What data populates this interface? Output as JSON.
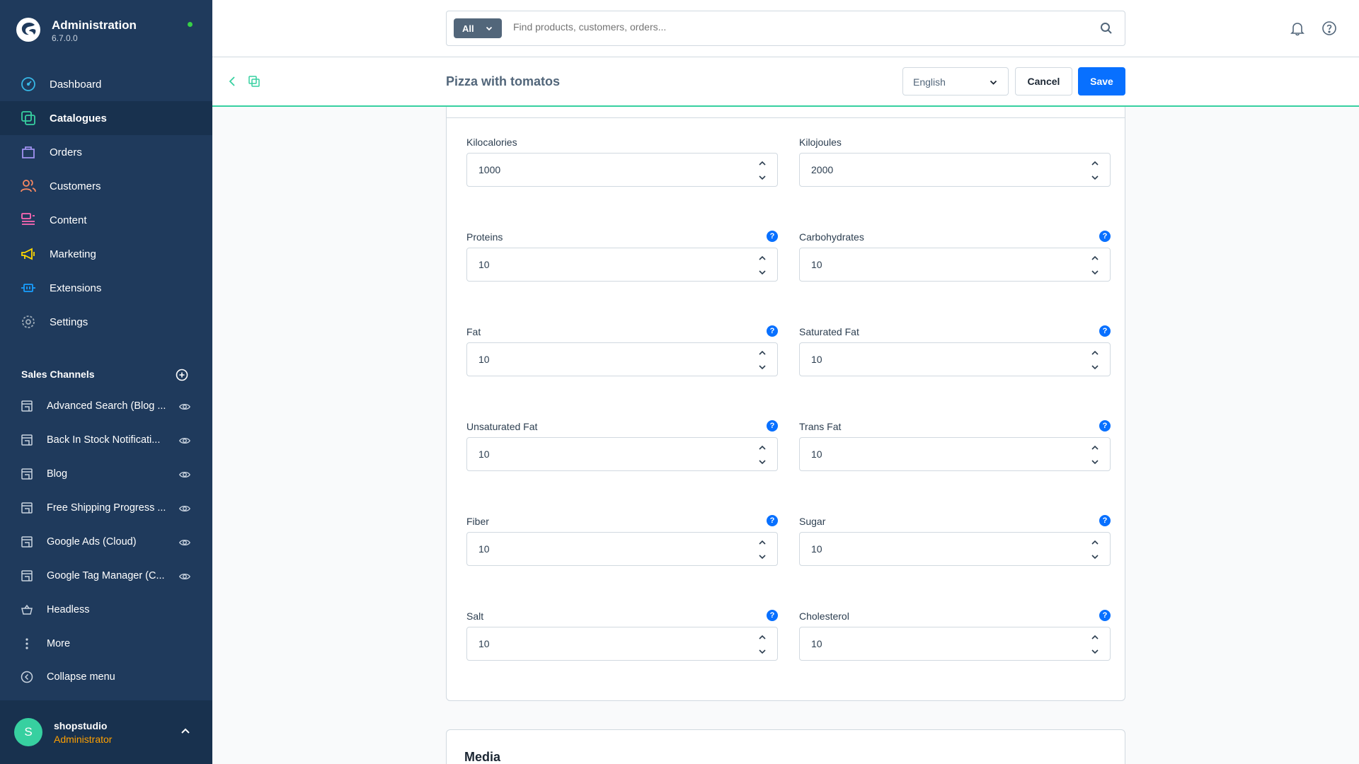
{
  "brand": {
    "title": "Administration",
    "version": "6.7.0.0"
  },
  "nav": [
    {
      "label": "Dashboard",
      "icon": "dashboard-icon"
    },
    {
      "label": "Catalogues",
      "icon": "catalogue-icon"
    },
    {
      "label": "Orders",
      "icon": "orders-icon"
    },
    {
      "label": "Customers",
      "icon": "customers-icon"
    },
    {
      "label": "Content",
      "icon": "content-icon"
    },
    {
      "label": "Marketing",
      "icon": "marketing-icon"
    },
    {
      "label": "Extensions",
      "icon": "extensions-icon"
    },
    {
      "label": "Settings",
      "icon": "settings-icon"
    }
  ],
  "sales_channels": {
    "title": "Sales Channels",
    "items": [
      {
        "label": "Advanced Search (Blog ..."
      },
      {
        "label": "Back In Stock Notificati..."
      },
      {
        "label": "Blog"
      },
      {
        "label": "Free Shipping Progress ..."
      },
      {
        "label": "Google Ads (Cloud)"
      },
      {
        "label": "Google Tag Manager (C..."
      },
      {
        "label": "Headless"
      }
    ],
    "more": "More",
    "collapse": "Collapse menu"
  },
  "user": {
    "initial": "S",
    "name": "shopstudio",
    "role": "Administrator"
  },
  "search": {
    "type": "All",
    "placeholder": "Find products, customers, orders..."
  },
  "smartbar": {
    "title": "Pizza with tomatos",
    "language": "English",
    "cancel": "Cancel",
    "save": "Save"
  },
  "fields": {
    "kilocalories": {
      "label": "Kilocalories",
      "value": "1000"
    },
    "kilojoules": {
      "label": "Kilojoules",
      "value": "2000"
    },
    "proteins": {
      "label": "Proteins",
      "value": "10"
    },
    "carbohydrates": {
      "label": "Carbohydrates",
      "value": "10"
    },
    "fat": {
      "label": "Fat",
      "value": "10"
    },
    "saturated_fat": {
      "label": "Saturated Fat",
      "value": "10"
    },
    "unsaturated_fat": {
      "label": "Unsaturated Fat",
      "value": "10"
    },
    "trans_fat": {
      "label": "Trans Fat",
      "value": "10"
    },
    "fiber": {
      "label": "Fiber",
      "value": "10"
    },
    "sugar": {
      "label": "Sugar",
      "value": "10"
    },
    "salt": {
      "label": "Salt",
      "value": "10"
    },
    "cholesterol": {
      "label": "Cholesterol",
      "value": "10"
    }
  },
  "help_glyph": "?",
  "media": {
    "title": "Media"
  },
  "colors": {
    "sidebar": "#1f3a5c",
    "accent": "#0870ff",
    "active_line": "#37d0a0",
    "admin_role": "#ffa000"
  }
}
